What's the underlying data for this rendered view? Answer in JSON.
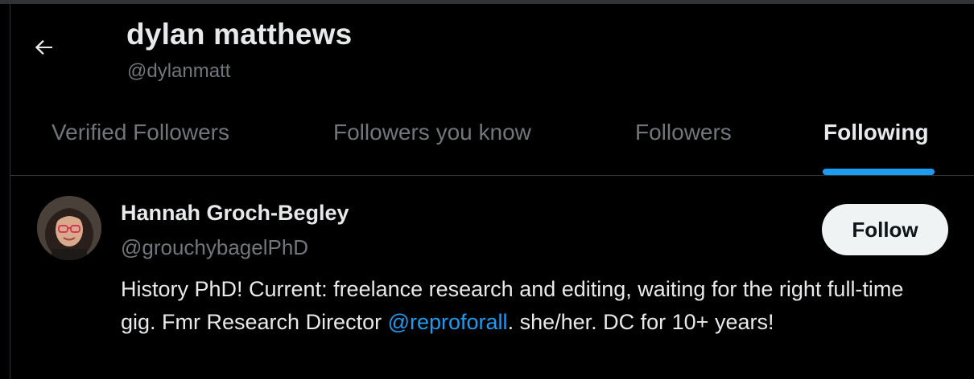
{
  "header": {
    "name": "dylan matthews",
    "handle": "@dylanmatt"
  },
  "tabs": [
    {
      "label": "Verified Followers",
      "active": false
    },
    {
      "label": "Followers you know",
      "active": false
    },
    {
      "label": "Followers",
      "active": false
    },
    {
      "label": "Following",
      "active": true
    }
  ],
  "user": {
    "name": "Hannah Groch-Begley",
    "handle": "@grouchybagelPhD",
    "follow_label": "Follow",
    "bio_before": "History PhD! Current: freelance research and editing, waiting for the right full-time gig. Fmr Research Director ",
    "bio_mention": "@reproforall",
    "bio_after": ". she/her. DC for 10+ years!"
  },
  "colors": {
    "accent": "#1d9bf0",
    "text_primary": "#e7e9ea",
    "text_secondary": "#71767b",
    "background": "#000000",
    "divider": "#2f3336"
  }
}
